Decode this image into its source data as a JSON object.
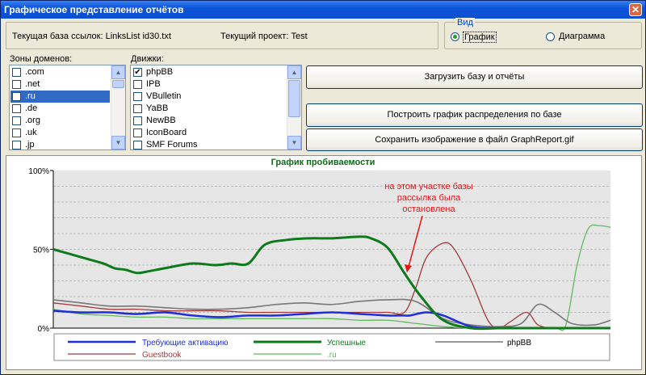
{
  "window": {
    "title": "Графическое представление отчётов",
    "close_glyph": "✕"
  },
  "info": {
    "links_db_label": "Текущая база ссылок: LinksList id30.txt",
    "project_label": "Текущий проект: Test"
  },
  "view": {
    "title": "Вид",
    "options": [
      {
        "label": "График",
        "selected": true
      },
      {
        "label": "Диаграмма",
        "selected": false
      }
    ]
  },
  "zones": {
    "label": "Зоны доменов:",
    "items": [
      {
        "label": ".com",
        "checked": false,
        "selected": false
      },
      {
        "label": ".net",
        "checked": false,
        "selected": false
      },
      {
        "label": ".ru",
        "checked": true,
        "selected": true
      },
      {
        "label": ".de",
        "checked": false,
        "selected": false
      },
      {
        "label": ".org",
        "checked": false,
        "selected": false
      },
      {
        "label": ".uk",
        "checked": false,
        "selected": false
      },
      {
        "label": ".jp",
        "checked": false,
        "selected": false
      }
    ]
  },
  "engines": {
    "label": "Движки:",
    "items": [
      {
        "label": "phpBB",
        "checked": true
      },
      {
        "label": "IPB",
        "checked": false
      },
      {
        "label": "VBulletin",
        "checked": false
      },
      {
        "label": "YaBB",
        "checked": false
      },
      {
        "label": "NewBB",
        "checked": false
      },
      {
        "label": "IconBoard",
        "checked": false
      },
      {
        "label": "SMF Forums",
        "checked": false
      }
    ]
  },
  "buttons": {
    "load": "Загрузить базу и отчёты",
    "build": "Построить график распределения по базе",
    "save": "Сохранить изображение в файл GraphReport.gif"
  },
  "chart_data": {
    "type": "line",
    "title": "График пробиваемости",
    "y_ticks": [
      "0%",
      "50%",
      "100%"
    ],
    "ylim": [
      0,
      100
    ],
    "xlim": [
      0,
      100
    ],
    "grid": true,
    "legend_placement": "bottom",
    "annotation": "на этом участке базы рассылка была остановлена",
    "series": [
      {
        "name": "Требующие активацию",
        "color": "#1f2fd6",
        "width": 2.5,
        "x": [
          0,
          5,
          10,
          15,
          20,
          25,
          30,
          35,
          40,
          45,
          50,
          55,
          60,
          62,
          63,
          64,
          67,
          70,
          75,
          80,
          85,
          90,
          95,
          100
        ],
        "y": [
          11,
          10,
          10,
          9,
          10,
          8,
          7,
          8,
          8,
          9,
          10,
          9,
          8,
          8,
          8,
          8,
          10,
          8,
          1,
          0,
          0,
          0,
          0,
          0
        ]
      },
      {
        "name": "Успешные",
        "color": "#0e7a1c",
        "width": 3,
        "x": [
          0,
          3,
          6,
          9,
          11,
          13,
          15,
          17,
          20,
          25,
          29,
          32,
          35,
          38,
          42,
          46,
          50,
          55,
          57,
          60,
          63,
          66,
          70,
          75,
          80,
          85,
          90,
          93,
          95,
          97,
          100
        ],
        "y": [
          50,
          47,
          44,
          41,
          38,
          37,
          35,
          36,
          38,
          41,
          40,
          41,
          41,
          53,
          56,
          57,
          57,
          58,
          57,
          51,
          35,
          20,
          5,
          0,
          0,
          0,
          0,
          0,
          0,
          0,
          0
        ]
      },
      {
        "name": "phpBB",
        "color": "#777777",
        "width": 1.6,
        "x": [
          0,
          5,
          10,
          15,
          20,
          25,
          30,
          35,
          40,
          45,
          50,
          55,
          60,
          65,
          70,
          75,
          80,
          84,
          87,
          90,
          93,
          97,
          100
        ],
        "y": [
          18,
          16,
          14,
          14,
          13,
          12,
          12,
          13,
          15,
          16,
          15,
          17,
          18,
          17,
          6,
          2,
          1,
          3,
          15,
          10,
          3,
          2,
          5
        ]
      },
      {
        "name": "Guestbook",
        "color": "#a23a3a",
        "width": 1.3,
        "x": [
          0,
          5,
          10,
          15,
          20,
          25,
          30,
          35,
          40,
          45,
          50,
          55,
          60,
          63,
          65,
          67,
          70,
          72,
          75,
          78,
          80,
          82,
          85,
          87,
          90,
          95,
          100
        ],
        "y": [
          16,
          14,
          12,
          12,
          11,
          11,
          11,
          10,
          10,
          10,
          10,
          10,
          10,
          10,
          25,
          45,
          54,
          50,
          30,
          5,
          0,
          4,
          10,
          2,
          0,
          0,
          0
        ]
      },
      {
        "name": ".ru",
        "color": "#5fba5f",
        "width": 1.3,
        "x": [
          0,
          5,
          10,
          15,
          20,
          25,
          30,
          35,
          40,
          45,
          50,
          55,
          60,
          65,
          70,
          75,
          80,
          85,
          90,
          92,
          94,
          96,
          98,
          100
        ],
        "y": [
          12,
          9,
          8,
          7,
          7,
          6,
          6,
          6,
          6,
          6,
          6,
          5,
          5,
          3,
          1,
          0,
          0,
          0,
          0,
          2,
          40,
          63,
          65,
          64
        ]
      }
    ]
  }
}
